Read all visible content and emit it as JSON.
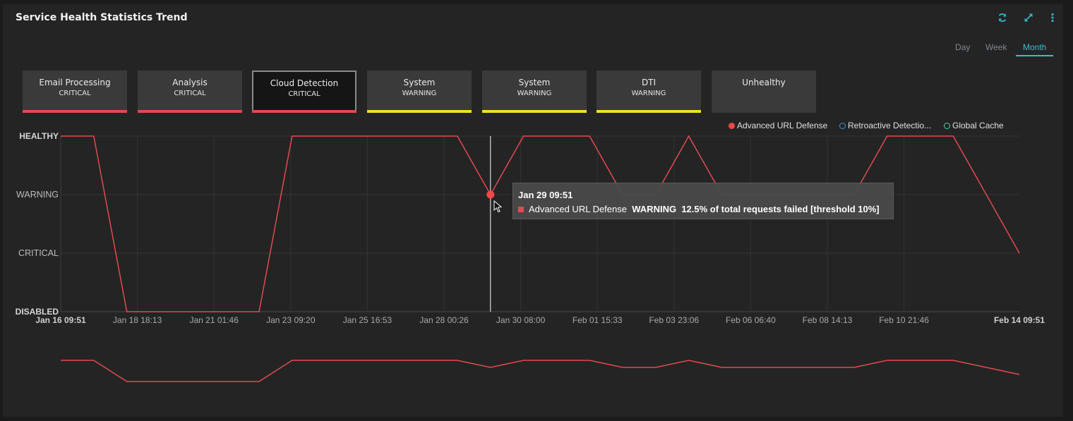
{
  "title": "Service Health Statistics Trend",
  "toolbar": {
    "refresh_icon": "refresh-icon",
    "expand_icon": "expand-icon",
    "more_icon": "more-vertical-icon"
  },
  "range_tabs": [
    {
      "label": "Day",
      "active": false
    },
    {
      "label": "Week",
      "active": false
    },
    {
      "label": "Month",
      "active": true
    }
  ],
  "services": [
    {
      "name": "Email Processing",
      "status": "CRITICAL",
      "color": "#e24a4f",
      "selected": false
    },
    {
      "name": "Analysis",
      "status": "CRITICAL",
      "color": "#e24a4f",
      "selected": false
    },
    {
      "name": "Cloud Detection",
      "status": "CRITICAL",
      "color": "#e24a4f",
      "selected": true
    },
    {
      "name": "System",
      "status": "WARNING",
      "color": "#f4e124",
      "selected": false
    },
    {
      "name": "System",
      "status": "WARNING",
      "color": "#f4e124",
      "selected": false
    },
    {
      "name": "DTI",
      "status": "WARNING",
      "color": "#f4e124",
      "selected": false
    },
    {
      "name": "Unhealthy",
      "status": "",
      "color": "",
      "selected": false
    }
  ],
  "legend": [
    {
      "label": "Advanced URL Defense",
      "color": "#f04747",
      "filled": true
    },
    {
      "label": "Retroactive Detectio...",
      "color": "#3d8fd6",
      "filled": false
    },
    {
      "label": "Global Cache",
      "color": "#4fcf9a",
      "filled": false
    }
  ],
  "tooltip": {
    "date": "Jan 29 09:51",
    "series": "Advanced URL Defense",
    "status": "WARNING",
    "message": "12.5% of total requests failed [threshold 10%]",
    "color": "#e24a4f"
  },
  "chart_data": {
    "type": "line",
    "xlabel": "",
    "ylabel": "",
    "y_levels": [
      "DISABLED",
      "CRITICAL",
      "WARNING",
      "HEALTHY"
    ],
    "x_ticks": [
      "Jan 16 09:51",
      "Jan 18 18:13",
      "Jan 21 01:46",
      "Jan 23 09:20",
      "Jan 25 16:53",
      "Jan 28 00:26",
      "Jan 30 08:00",
      "Feb 01 15:33",
      "Feb 03 23:06",
      "Feb 06 06:40",
      "Feb 08 14:13",
      "Feb 10 21:46",
      "Feb 14 09:51"
    ],
    "xlim": [
      0,
      29
    ],
    "ylim": [
      0,
      3
    ],
    "grid": true,
    "legend_position": "top-right",
    "series": [
      {
        "name": "Advanced URL Defense",
        "color": "#e24a4f",
        "x": [
          0,
          1,
          2,
          3,
          4,
          5,
          6,
          7,
          8,
          9,
          10,
          11,
          12,
          13,
          14,
          15,
          16,
          17,
          18,
          19,
          20,
          21,
          22,
          23,
          24,
          25,
          26,
          27,
          28,
          29
        ],
        "y": [
          3,
          3,
          0,
          0,
          0,
          0,
          0,
          3,
          3,
          3,
          3,
          3,
          3,
          2,
          3,
          3,
          3,
          2,
          2,
          3,
          2,
          2,
          2,
          2,
          2,
          3,
          3,
          3,
          2,
          1
        ]
      }
    ],
    "highlight": {
      "x": 13,
      "y": 2
    },
    "navigator": true
  }
}
